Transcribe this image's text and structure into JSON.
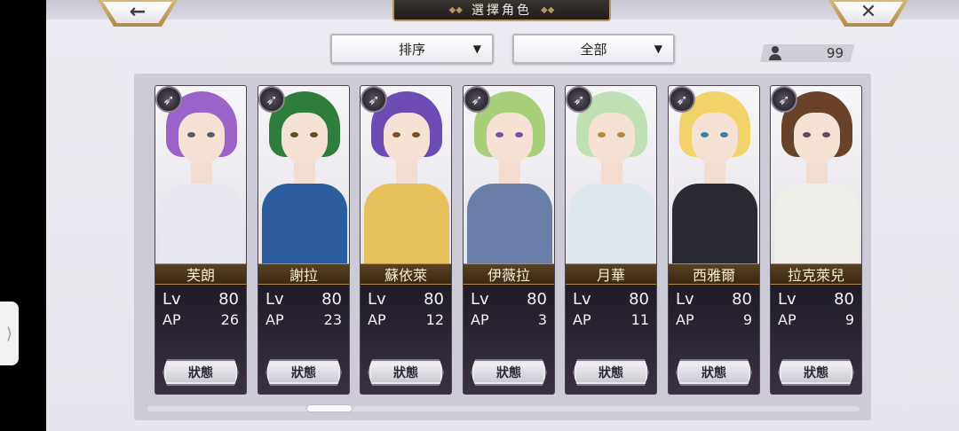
{
  "header": {
    "title": "選擇角色",
    "back_icon": "←",
    "close_icon": "✕"
  },
  "filters": {
    "sort_label": "排序",
    "filter_label": "全部",
    "caret": "▼"
  },
  "character_count": "99",
  "side_handle_glyph": "⟩",
  "status_label": "狀態",
  "characters": [
    {
      "name": "芙朗",
      "lv_label": "Lv",
      "lv": "80",
      "ap_label": "AP",
      "ap": "26",
      "class_icon": "bow-icon",
      "hair": "#9b63c9",
      "eye": "#5a5a68",
      "outfit": "#e9e7ef"
    },
    {
      "name": "謝拉",
      "lv_label": "Lv",
      "lv": "80",
      "ap_label": "AP",
      "ap": "23",
      "class_icon": "bow-icon",
      "hair": "#2f7d3a",
      "eye": "#6b4c22",
      "outfit": "#2c5d9e"
    },
    {
      "name": "蘇依萊",
      "lv_label": "Lv",
      "lv": "80",
      "ap_label": "AP",
      "ap": "12",
      "class_icon": "bow-icon",
      "hair": "#6d4bb4",
      "eye": "#7a4f2a",
      "outfit": "#e8c15d"
    },
    {
      "name": "伊薇拉",
      "lv_label": "Lv",
      "lv": "80",
      "ap_label": "AP",
      "ap": "3",
      "class_icon": "bow-icon",
      "hair": "#a8d07a",
      "eye": "#7b4ea0",
      "outfit": "#6a7fa8"
    },
    {
      "name": "月華",
      "lv_label": "Lv",
      "lv": "80",
      "ap_label": "AP",
      "ap": "11",
      "class_icon": "crossbow-icon",
      "hair": "#bfe0b4",
      "eye": "#b08a3a",
      "outfit": "#dfe8ee"
    },
    {
      "name": "西雅爾",
      "lv_label": "Lv",
      "lv": "80",
      "ap_label": "AP",
      "ap": "9",
      "class_icon": "crossbow-icon",
      "hair": "#f1d36a",
      "eye": "#3a7fa8",
      "outfit": "#2a2a32"
    },
    {
      "name": "拉克萊兒",
      "lv_label": "Lv",
      "lv": "80",
      "ap_label": "AP",
      "ap": "9",
      "class_icon": "crossbow-icon",
      "hair": "#6a4228",
      "eye": "#5d4a6a",
      "outfit": "#f0eee8"
    }
  ]
}
